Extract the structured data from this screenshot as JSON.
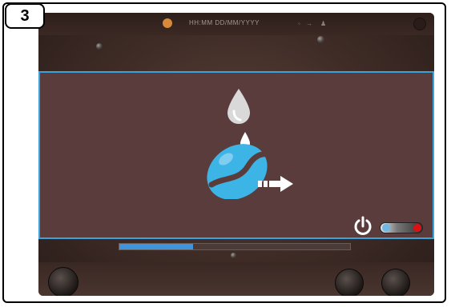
{
  "step": {
    "number": "3"
  },
  "status_bar": {
    "datetime_format": "HH:MM  DD/MM/YYYY",
    "left_icon": "orange-circle-icon",
    "right_icons": [
      "signal-icon",
      "person-icon"
    ]
  },
  "dialog": {
    "illustration": "water-droplet-coffee-bean-icon",
    "arrow_icon": "arrow-right-icon"
  },
  "progress": {
    "value_percent": 32
  },
  "power": {
    "icon": "power-icon",
    "toggle_state": "on"
  },
  "colors": {
    "accent": "#3aa3db",
    "progress": "#3e95dc",
    "background": "#5b3c3c",
    "toggle_indicator": "#dd1111"
  }
}
